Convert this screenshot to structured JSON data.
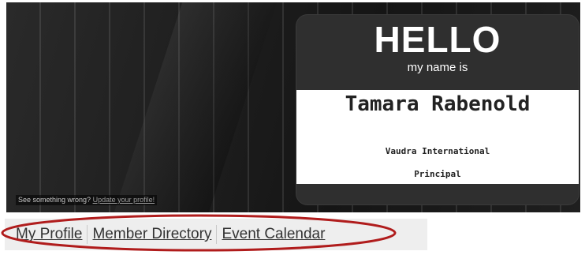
{
  "banner": {
    "badge": {
      "greeting": "HELLO",
      "subtitle": "my name is",
      "name": "Tamara Rabenold",
      "company": "Vaudra International",
      "title": "Principal"
    },
    "notice": {
      "text": "See something wrong?",
      "link_label": "Update your profile!"
    }
  },
  "nav": {
    "items": [
      {
        "label": "My Profile"
      },
      {
        "label": "Member Directory"
      },
      {
        "label": "Event Calendar"
      }
    ]
  },
  "colors": {
    "badge_bg": "#2f2f2f",
    "annotation_oval": "#b01c1c",
    "nav_bg": "#eeeeee"
  }
}
